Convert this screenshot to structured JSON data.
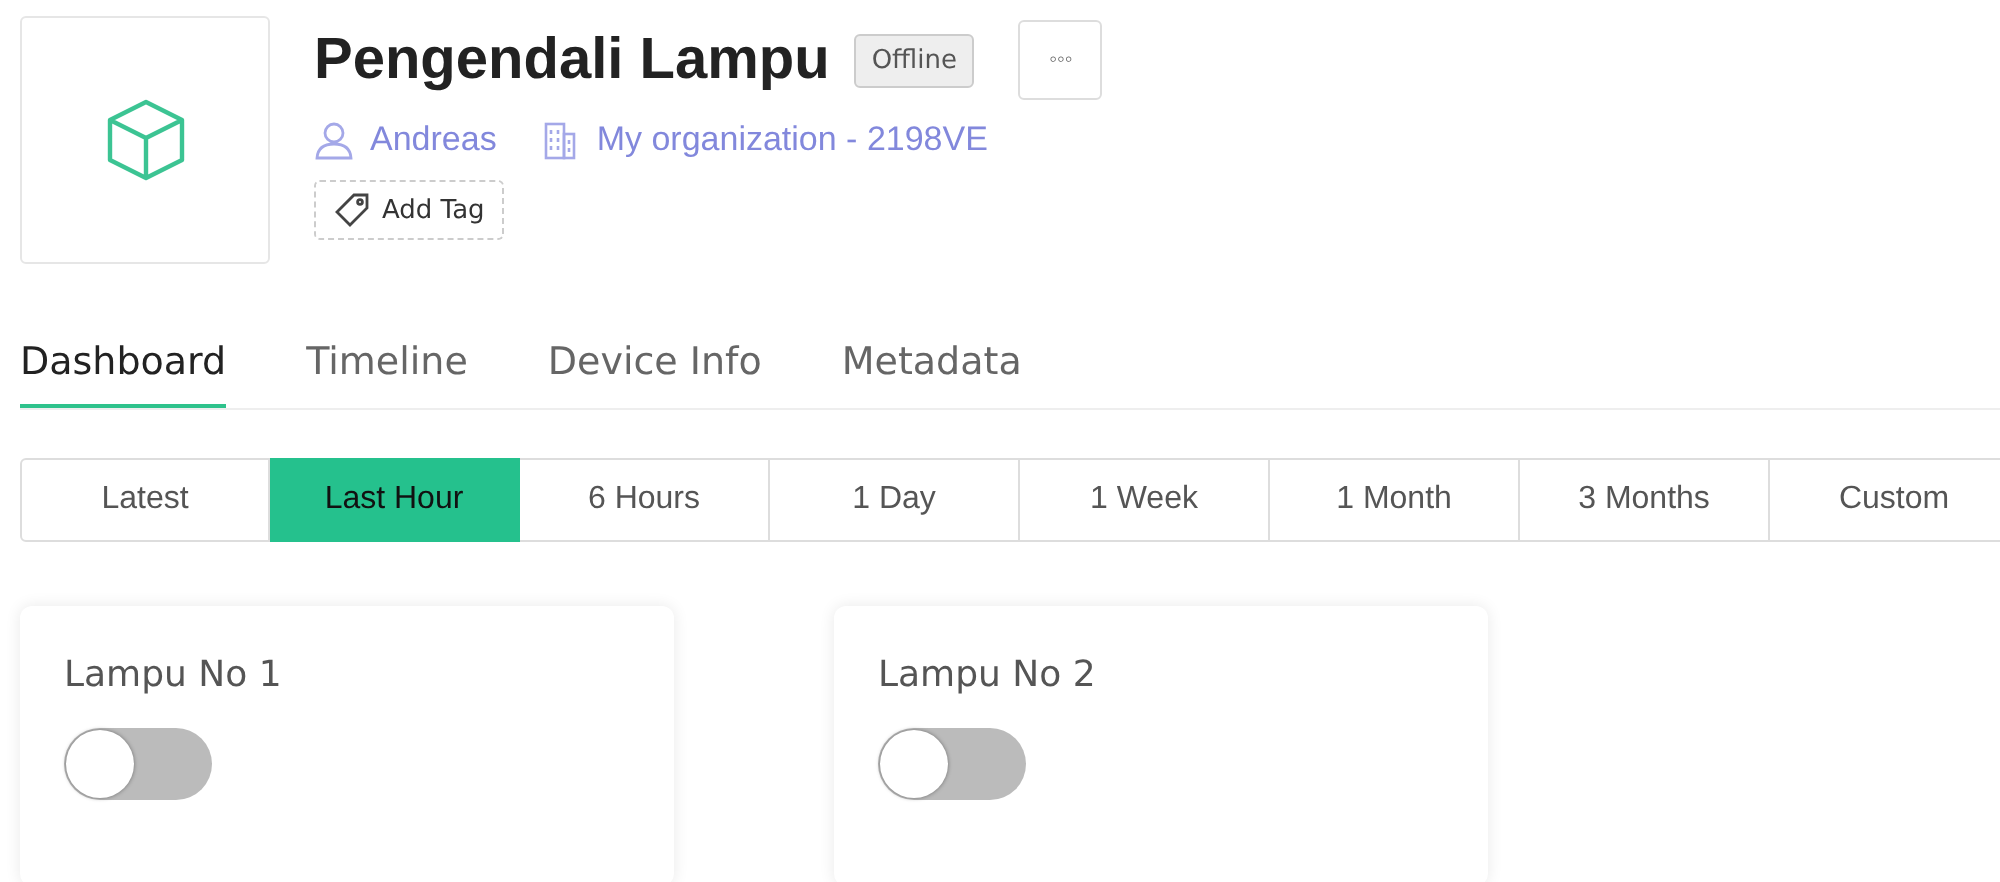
{
  "device": {
    "title": "Pengendali Lampu",
    "status": "Offline",
    "more": "◦◦◦",
    "owner": "Andreas",
    "organization": "My organization - 2198VE",
    "add_tag": "Add Tag"
  },
  "tabs": [
    {
      "label": "Dashboard",
      "selected": true
    },
    {
      "label": "Timeline",
      "selected": false
    },
    {
      "label": "Device Info",
      "selected": false
    },
    {
      "label": "Metadata",
      "selected": false
    }
  ],
  "time_ranges": [
    {
      "label": "Latest",
      "selected": false
    },
    {
      "label": "Last Hour",
      "selected": true
    },
    {
      "label": "6 Hours",
      "selected": false
    },
    {
      "label": "1 Day",
      "selected": false
    },
    {
      "label": "1 Week",
      "selected": false
    },
    {
      "label": "1 Month",
      "selected": false
    },
    {
      "label": "3 Months",
      "selected": false
    },
    {
      "label": "Custom",
      "selected": false
    }
  ],
  "widgets": [
    {
      "title": "Lampu No 1",
      "on": false
    },
    {
      "title": "Lampu No 2",
      "on": false
    }
  ]
}
